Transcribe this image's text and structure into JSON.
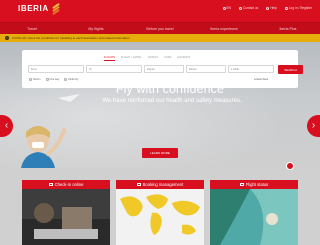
{
  "brand": {
    "logo_text": "IBERIA"
  },
  "colors": {
    "brand_red": "#d70f1e",
    "alert_yellow": "#e6ac0c"
  },
  "toplinks": [
    {
      "icon": "globe-icon",
      "label": "EN"
    },
    {
      "icon": "chat-icon",
      "label": "Contact us"
    },
    {
      "icon": "help-icon",
      "label": "Help"
    },
    {
      "icon": "user-icon",
      "label": "Log in / Register"
    }
  ],
  "nav": {
    "items": [
      "Travel",
      "My flights",
      "Before you travel",
      "Iberia experience",
      "Iberia Plus"
    ]
  },
  "alert": {
    "text": "COVID-19: check the conditions for travelling to each destination and related information"
  },
  "search": {
    "tabs": [
      "FLIGHTS",
      "FLIGHT + HOTEL",
      "HOTELS",
      "CARS",
      "HOLIDAYS"
    ],
    "origin_placeholder": "From",
    "destination_placeholder": "To",
    "depart_placeholder": "Depart",
    "return_placeholder": "Return",
    "passengers_value": "1 Adult",
    "trip_options": [
      "Return",
      "One way",
      "Multi-city"
    ],
    "lowcost_label": "Lowest fares",
    "search_button": "SEARCH"
  },
  "hero": {
    "headline": "Fly with confidence",
    "subline": "We have reinforced our health and safety measures.",
    "cta": "LEARN MORE"
  },
  "carousel": {
    "prev": "‹",
    "next": "›"
  },
  "cards": [
    {
      "label": "Check-in online",
      "icon": "screen-icon"
    },
    {
      "label": "Booking management",
      "icon": "briefcase-icon"
    },
    {
      "label": "Flight status",
      "icon": "plane-icon"
    }
  ]
}
